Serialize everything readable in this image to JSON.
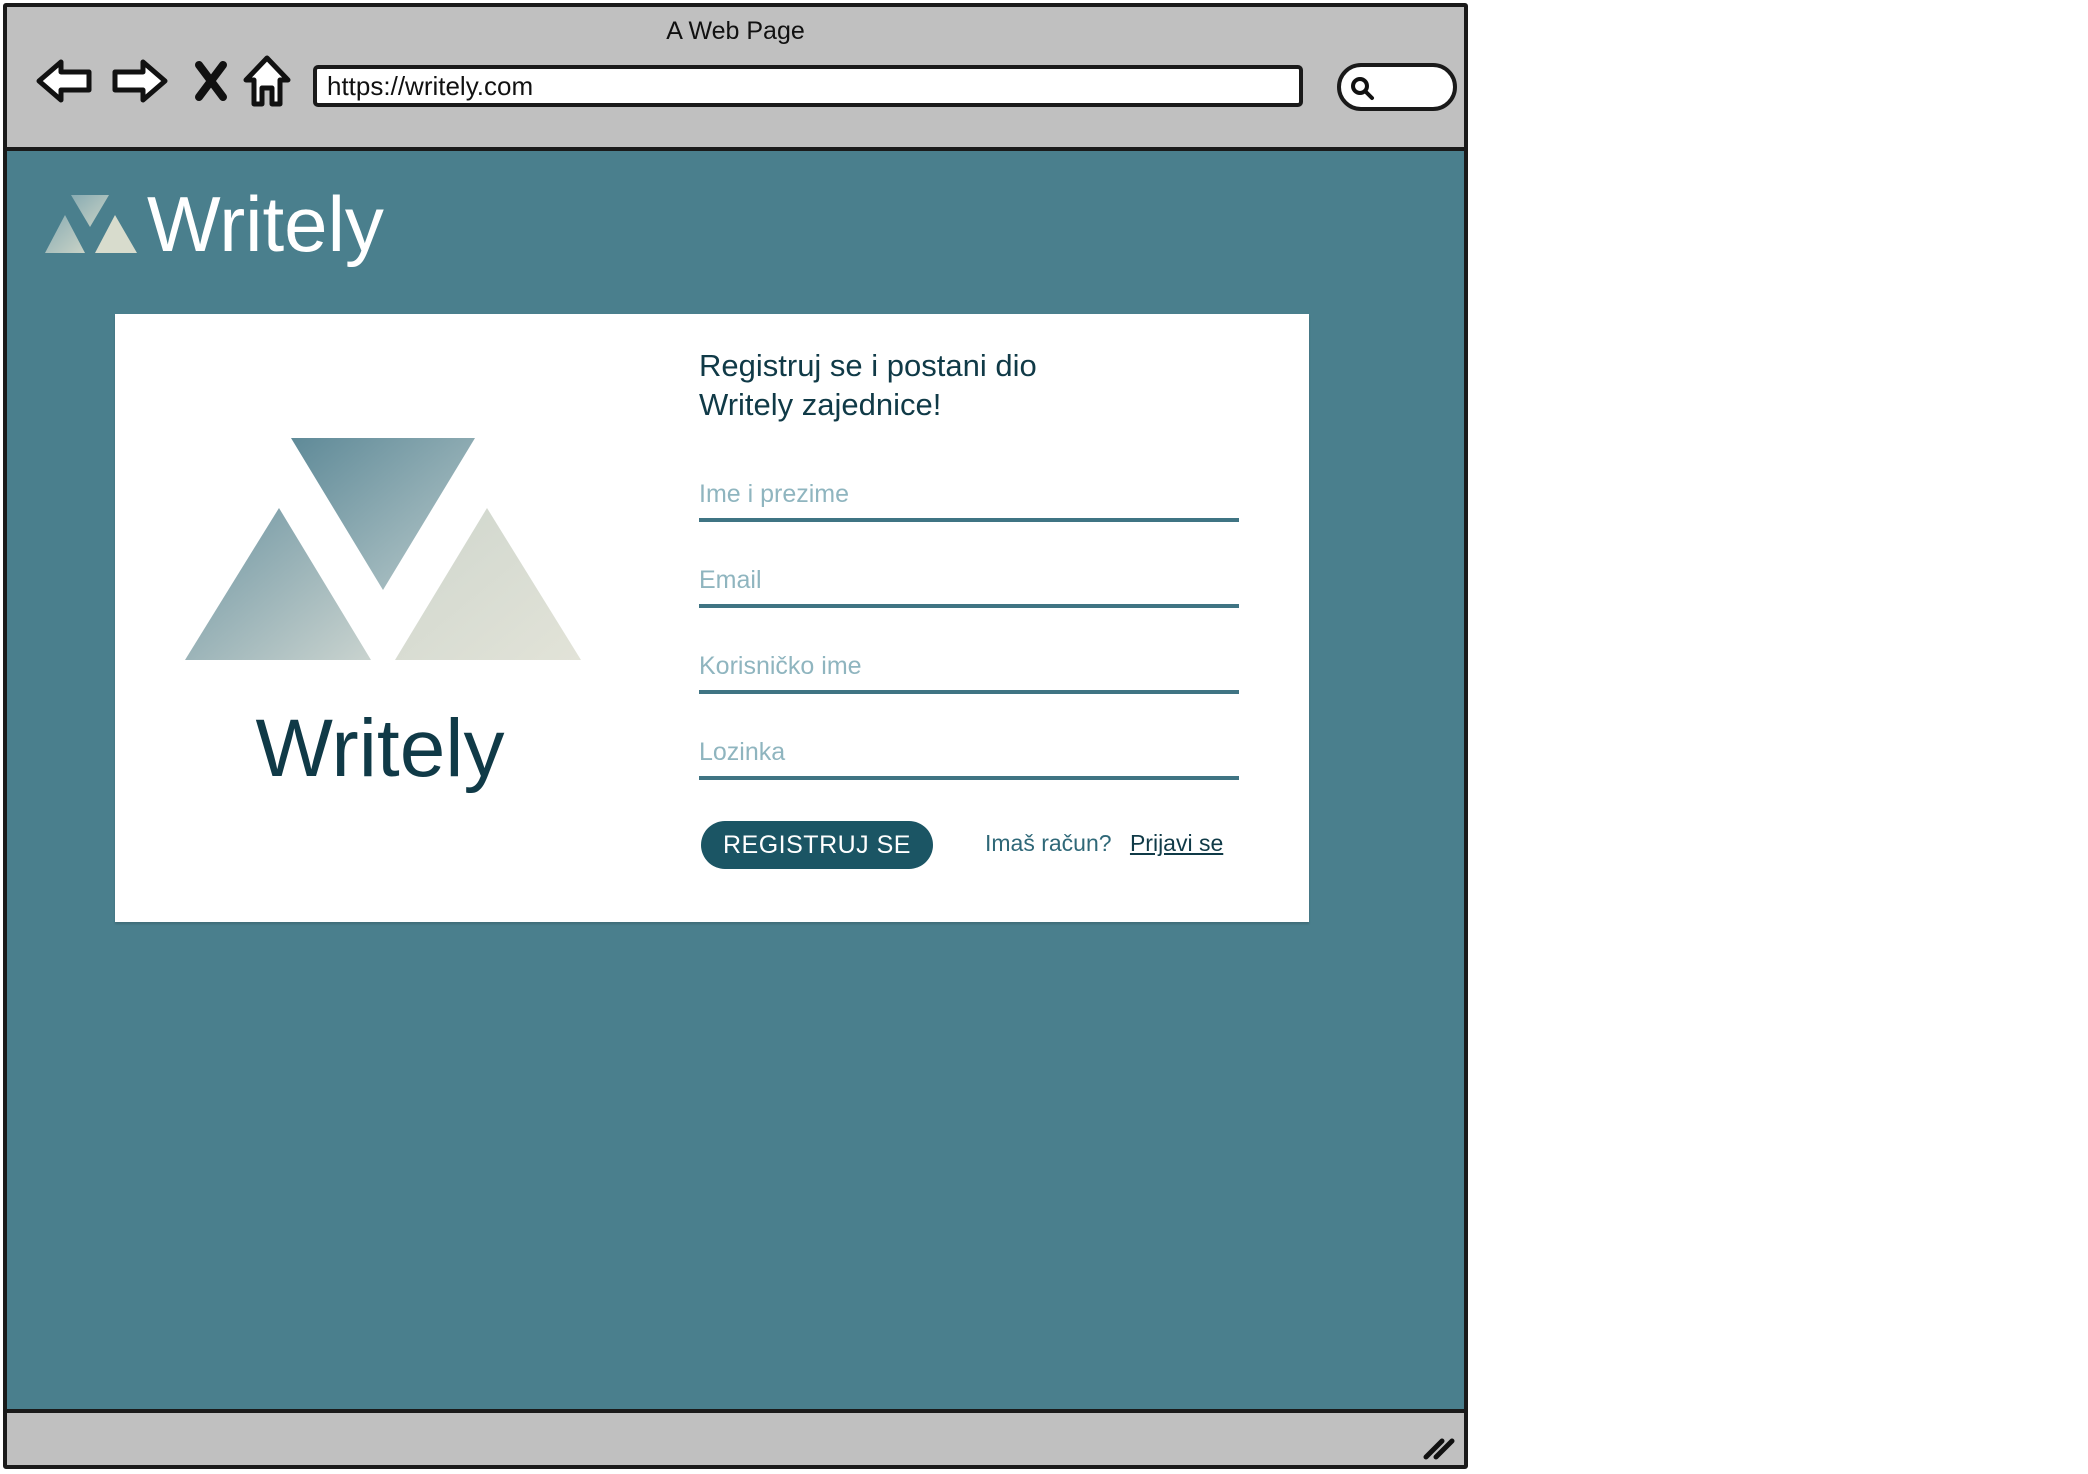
{
  "window": {
    "title": "A Web Page",
    "url": "https://writely.com"
  },
  "nav_icons": [
    "back-arrow-icon",
    "forward-arrow-icon",
    "stop-icon",
    "home-icon"
  ],
  "colors": {
    "page_bg": "#4a7f8d",
    "card_bg": "#ffffff",
    "brand_dark": "#103a47",
    "button_bg": "#1b5564",
    "input_line": "#3f7483",
    "placeholder": "#8fb5bf"
  },
  "header": {
    "brand_name": "Writely"
  },
  "card": {
    "brand_name": "Writely",
    "heading_line1": "Registruj se i postani dio",
    "heading_line2": "Writely zajednice!",
    "fields": {
      "full_name": {
        "placeholder": "Ime i prezime",
        "value": ""
      },
      "email": {
        "placeholder": "Email",
        "value": ""
      },
      "username": {
        "placeholder": "Korisničko ime",
        "value": ""
      },
      "password": {
        "placeholder": "Lozinka",
        "value": ""
      }
    },
    "register_label": "REGISTRUJ SE",
    "have_account_text": "Imaš račun?",
    "login_link": "Prijavi se"
  }
}
